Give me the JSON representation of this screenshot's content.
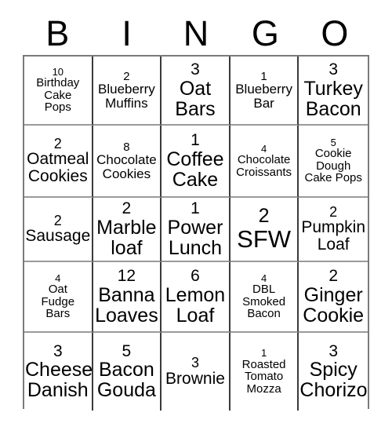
{
  "card": {
    "title": "BINGO",
    "headers": [
      "B",
      "I",
      "N",
      "G",
      "O"
    ],
    "rows": [
      [
        {
          "count": "10",
          "label": "Birthday\nCake\nPops",
          "size": "xs"
        },
        {
          "count": "2",
          "label": "Blueberry\nMuffins",
          "size": "sm"
        },
        {
          "count": "3",
          "label": "Oat\nBars",
          "size": "lg"
        },
        {
          "count": "1",
          "label": "Blueberry\nBar",
          "size": "sm"
        },
        {
          "count": "3",
          "label": "Turkey\nBacon",
          "size": "lg"
        }
      ],
      [
        {
          "count": "2",
          "label": "Oatmeal\nCookies",
          "size": "md"
        },
        {
          "count": "8",
          "label": "Chocolate\nCookies",
          "size": "sm"
        },
        {
          "count": "1",
          "label": "Coffee\nCake",
          "size": "lg"
        },
        {
          "count": "4",
          "label": "Chocolate\nCroissants",
          "size": "xs"
        },
        {
          "count": "5",
          "label": "Cookie\nDough\nCake Pops",
          "size": "xs"
        }
      ],
      [
        {
          "count": "2",
          "label": "Sausage",
          "size": "md"
        },
        {
          "count": "2",
          "label": "Marble\nloaf",
          "size": "lg"
        },
        {
          "count": "1",
          "label": "Power\nLunch",
          "size": "lg"
        },
        {
          "count": "2",
          "label": "SFW",
          "size": "xl"
        },
        {
          "count": "2",
          "label": "Pumpkin\nLoaf",
          "size": "md"
        }
      ],
      [
        {
          "count": "4",
          "label": "Oat\nFudge\nBars",
          "size": "xs"
        },
        {
          "count": "12",
          "label": "Banna\nLoaves",
          "size": "lg"
        },
        {
          "count": "6",
          "label": "Lemon\nLoaf",
          "size": "lg"
        },
        {
          "count": "4",
          "label": "DBL\nSmoked\nBacon",
          "size": "xs"
        },
        {
          "count": "2",
          "label": "Ginger\nCookie",
          "size": "lg"
        }
      ],
      [
        {
          "count": "3",
          "label": "Cheese\nDanish",
          "size": "lg"
        },
        {
          "count": "5",
          "label": "Bacon\nGouda",
          "size": "lg"
        },
        {
          "count": "3",
          "label": "Brownie",
          "size": "md"
        },
        {
          "count": "1",
          "label": "Roasted\nTomato\nMozza",
          "size": "xs"
        },
        {
          "count": "3",
          "label": "Spicy\nChorizo",
          "size": "lg"
        }
      ]
    ]
  },
  "colors": {
    "background": "#ffffff",
    "text": "#000000",
    "grid_line": "#3a3a3a",
    "grid_border": "#7a7a7a"
  }
}
